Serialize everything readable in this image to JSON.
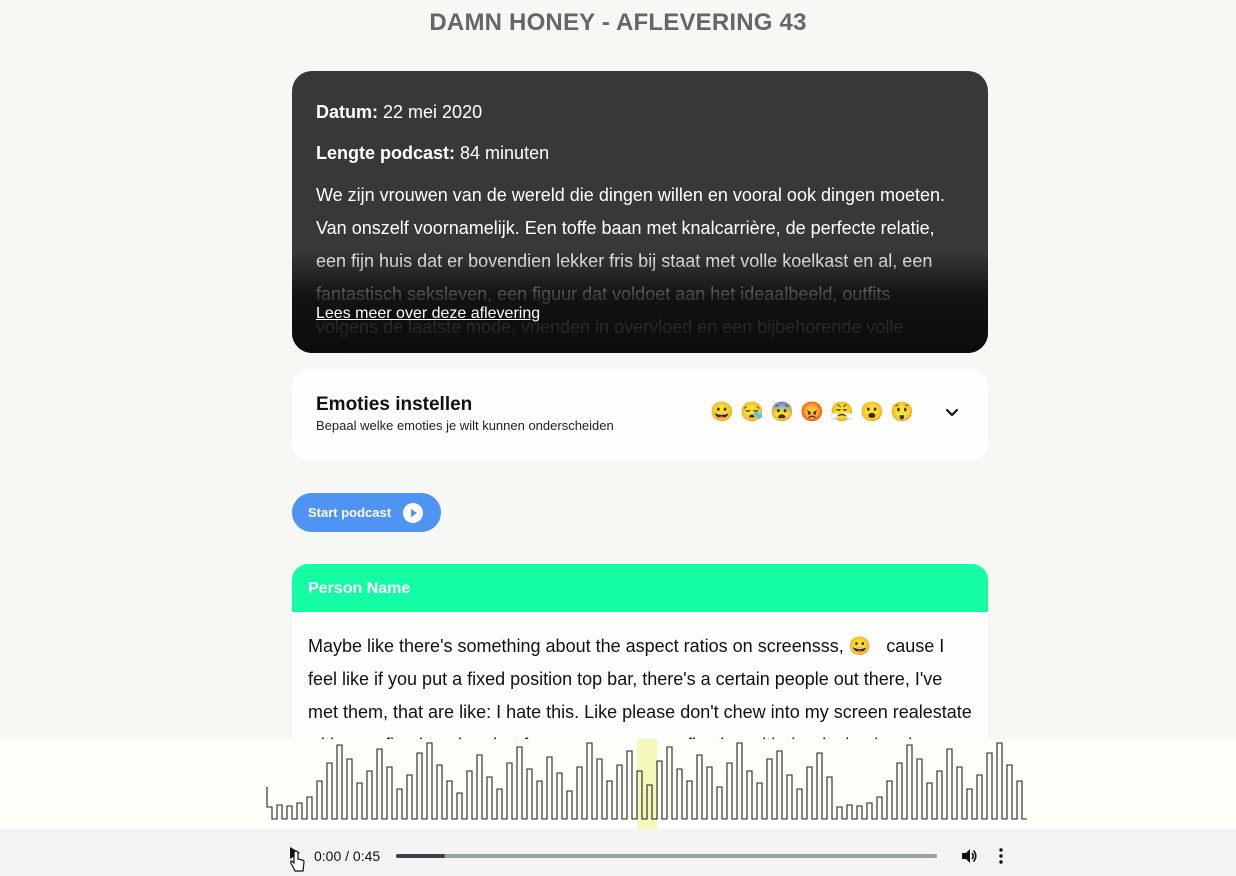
{
  "page": {
    "title": "DAMN HONEY - AFLEVERING 43"
  },
  "episode": {
    "date_label": "Datum:",
    "date_value": "22 mei 2020",
    "length_label": "Lengte podcast:",
    "length_value": "84 minuten",
    "description": "We zijn vrouwen van de wereld die dingen willen en vooral ook dingen moeten. Van onszelf voornamelijk. Een toffe baan met knalcarrière, de perfecte relatie, een fijn huis dat er bovendien lekker fris bij staat met volle koelkast en al, een fantastisch seksleven, een figuur dat voldoet aan het ideaalbeeld, outfits volgens de laatste mode, vrienden in overvloed en een bijbehorende volle sociale",
    "read_more": "Lees meer over deze aflevering"
  },
  "emotions": {
    "title": "Emoties instellen",
    "subtitle": "Bepaal welke emoties je wilt kunnen onderscheiden",
    "icons": [
      {
        "name": "grinning-face-icon",
        "glyph": "😀"
      },
      {
        "name": "sleepy-face-icon",
        "glyph": "😪"
      },
      {
        "name": "fearful-face-icon",
        "glyph": "😨"
      },
      {
        "name": "angry-face-icon",
        "glyph": "😡"
      },
      {
        "name": "steam-face-icon",
        "glyph": "😤"
      },
      {
        "name": "surprised-face-icon",
        "glyph": "😮"
      },
      {
        "name": "astonished-face-icon",
        "glyph": "😲"
      }
    ]
  },
  "actions": {
    "start_podcast": "Start podcast"
  },
  "transcript": {
    "person_name": "Person Name",
    "text_before": "Maybe like there's something about the aspect ratios on screensss,",
    "emoji": "😀",
    "text_after": "cause I feel like if you put a fixed position top bar, there's a certain people out there, I've met them, that are like: I hate this. Like please don't chew into my screen realestate with your fixed top bar, but for some reason my fixation with the design has been"
  },
  "player": {
    "time": "0:00 / 0:45",
    "progress_fraction": 0.09
  },
  "colors": {
    "accent_blue": "#4f93f3",
    "person_header": "#14fda4",
    "card_dark": "#383836",
    "waveform_highlight": "#f4f8b8"
  }
}
